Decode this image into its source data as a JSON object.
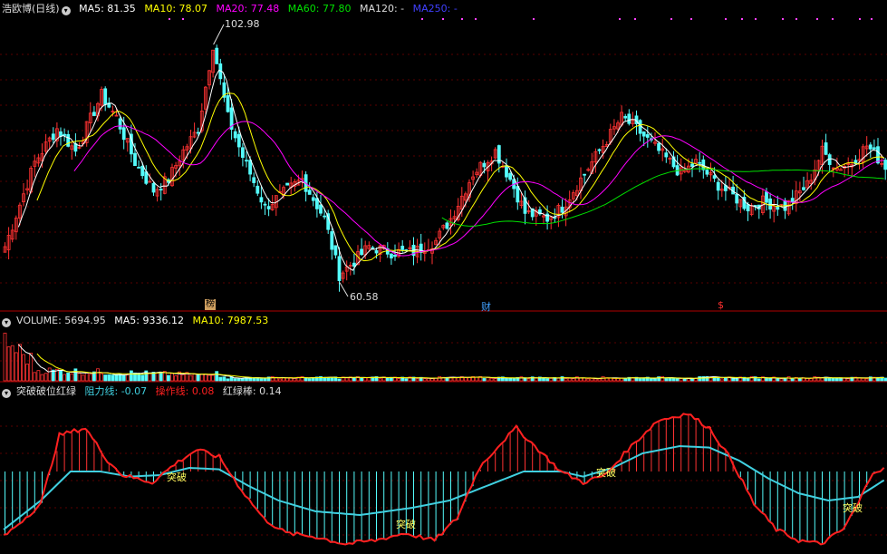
{
  "main_header": {
    "title": "浩欧博(日线)",
    "ma5": "MA5: 81.35",
    "ma10": "MA10: 78.07",
    "ma20": "MA20: 77.48",
    "ma60": "MA60: 77.80",
    "ma120": "MA120: -",
    "ma250": "MA250: -"
  },
  "volume_header": {
    "title": "VOLUME: 5694.95",
    "ma5": "MA5: 9336.12",
    "ma10": "MA10: 7987.53"
  },
  "indicator_header": {
    "title": "突破破位红绿",
    "resistance": "阻力线: -0.07",
    "operation": "操作线: 0.08",
    "bar": "红绿棒: 0.14"
  },
  "annotations": {
    "high": "102.98",
    "low": "60.58",
    "tag_bang": "榜",
    "tag_cai": "财",
    "tag_dollar": "$",
    "breakout": "突破"
  },
  "colors": {
    "up": "#ff3232",
    "down": "#54fcfc",
    "ma5": "#ffffff",
    "ma10": "#ffff00",
    "ma20": "#ff00ff",
    "ma60": "#00e000",
    "ma250": "#4040ff",
    "resistance": "#40d0e0",
    "operation": "#ff2020"
  },
  "chart_data": {
    "type": "candlestick",
    "ylim": [
      56,
      108
    ],
    "high_label": 102.98,
    "low_label": 60.58,
    "close_start": 67,
    "close_points": [
      [
        0,
        67
      ],
      [
        8,
        82
      ],
      [
        14,
        88
      ],
      [
        19,
        84
      ],
      [
        26,
        94
      ],
      [
        30,
        90
      ],
      [
        35,
        82
      ],
      [
        40,
        77
      ],
      [
        44,
        79
      ],
      [
        48,
        84
      ],
      [
        52,
        88
      ],
      [
        56,
        102.98
      ],
      [
        60,
        90
      ],
      [
        64,
        83
      ],
      [
        70,
        74
      ],
      [
        74,
        76
      ],
      [
        80,
        79
      ],
      [
        86,
        72
      ],
      [
        90,
        62
      ],
      [
        95,
        65
      ],
      [
        98,
        67
      ],
      [
        104,
        66
      ],
      [
        110,
        66
      ],
      [
        116,
        68
      ],
      [
        120,
        72
      ],
      [
        126,
        80
      ],
      [
        132,
        84
      ],
      [
        136,
        79
      ],
      [
        140,
        73
      ],
      [
        146,
        72
      ],
      [
        150,
        74
      ],
      [
        156,
        80
      ],
      [
        160,
        84
      ],
      [
        166,
        90
      ],
      [
        170,
        88
      ],
      [
        176,
        84
      ],
      [
        182,
        80
      ],
      [
        186,
        82
      ],
      [
        192,
        78
      ],
      [
        196,
        76
      ],
      [
        200,
        74
      ],
      [
        204,
        75
      ],
      [
        210,
        74
      ],
      [
        216,
        78
      ],
      [
        220,
        84
      ],
      [
        224,
        81
      ],
      [
        228,
        82
      ],
      [
        232,
        85
      ],
      [
        236,
        82
      ],
      [
        237,
        81.35
      ]
    ],
    "volume_ylim": [
      0,
      60000
    ],
    "volume_ma5": 9336.12,
    "volume_ma10": 7987.53,
    "volume_last": 5694.95,
    "indicator_ylim": [
      -1.05,
      1.05
    ],
    "indicator_last": {
      "resistance": -0.07,
      "operation": 0.08,
      "bar": 0.14
    }
  }
}
